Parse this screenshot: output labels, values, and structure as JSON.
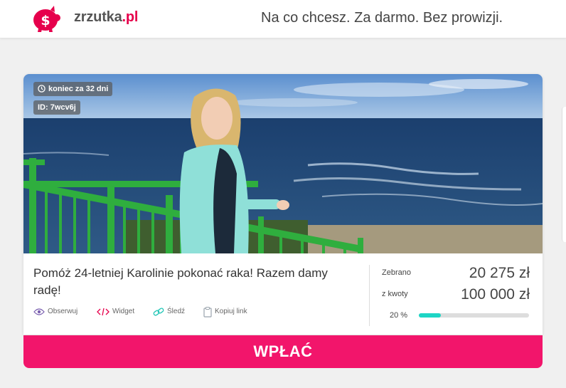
{
  "header": {
    "logo_name": "zrzutka",
    "logo_tld": ".pl",
    "tagline": "Na co chcesz. Za darmo. Bez prowizji."
  },
  "campaign": {
    "time_left": "koniec za 32 dni",
    "id_label": "ID: 7wcv6j",
    "title": "Pomóż 24-letniej Karolinie pokonać raka! Razem damy radę!",
    "actions": [
      {
        "label": "Obserwuj",
        "icon": "eye-icon"
      },
      {
        "label": "Widget",
        "icon": "code-icon"
      },
      {
        "label": "Śledź",
        "icon": "link-icon"
      },
      {
        "label": "Kopiuj link",
        "icon": "clipboard-icon"
      }
    ],
    "stats": {
      "collected_label": "Zebrano",
      "collected_value": "20 275 zł",
      "goal_label": "z kwoty",
      "goal_value": "100 000 zł",
      "percent_label": "20 %",
      "progress": 0.2
    },
    "pay_label": "WPŁAĆ"
  },
  "colors": {
    "brand_pink": "#e6004c",
    "pay_button": "#f2156b",
    "progress": "#1ed5c5"
  }
}
